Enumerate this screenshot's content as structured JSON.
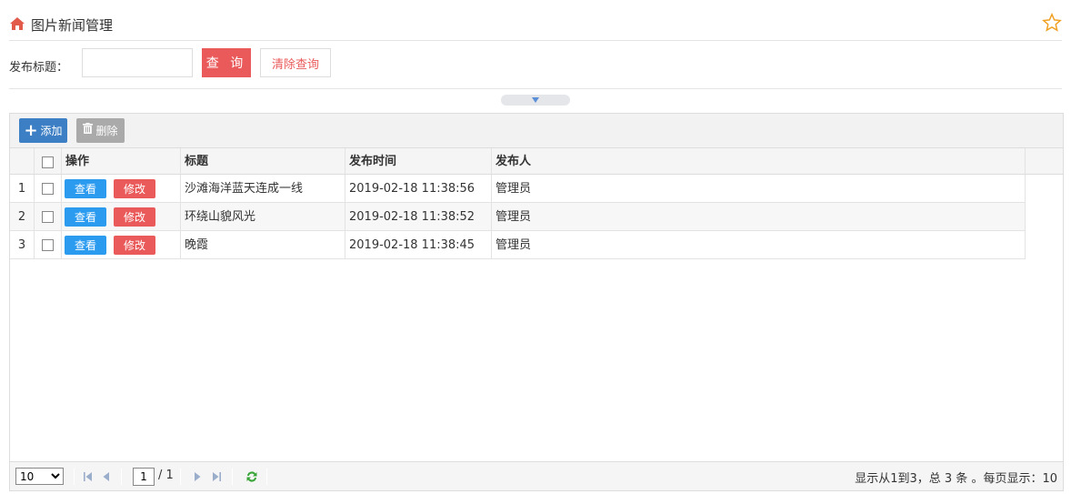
{
  "header": {
    "title": "图片新闻管理"
  },
  "search": {
    "label": "发布标题：",
    "value": "",
    "placeholder": "",
    "query_label": "查 询",
    "clear_label": "清除查询"
  },
  "toolbar": {
    "add_label": "添加",
    "delete_label": "删除"
  },
  "table": {
    "columns": {
      "op": "操作",
      "title": "标题",
      "time": "发布时间",
      "author": "发布人"
    },
    "view_label": "查看",
    "edit_label": "修改",
    "rows": [
      {
        "num": "1",
        "title": "沙滩海洋蓝天连成一线",
        "time": "2019-02-18 11:38:56",
        "author": "管理员"
      },
      {
        "num": "2",
        "title": "环绕山貌风光",
        "time": "2019-02-18 11:38:52",
        "author": "管理员"
      },
      {
        "num": "3",
        "title": "晚霞",
        "time": "2019-02-18 11:38:45",
        "author": "管理员"
      }
    ]
  },
  "pager": {
    "page_size": "10",
    "current_page": "1",
    "total_pages": "/ 1",
    "info": "显示从1到3，总 3 条 。每页显示：10"
  },
  "colors": {
    "accent_red": "#ea5a5a",
    "accent_blue": "#3c7fc4",
    "view_blue": "#2b9bf0"
  }
}
